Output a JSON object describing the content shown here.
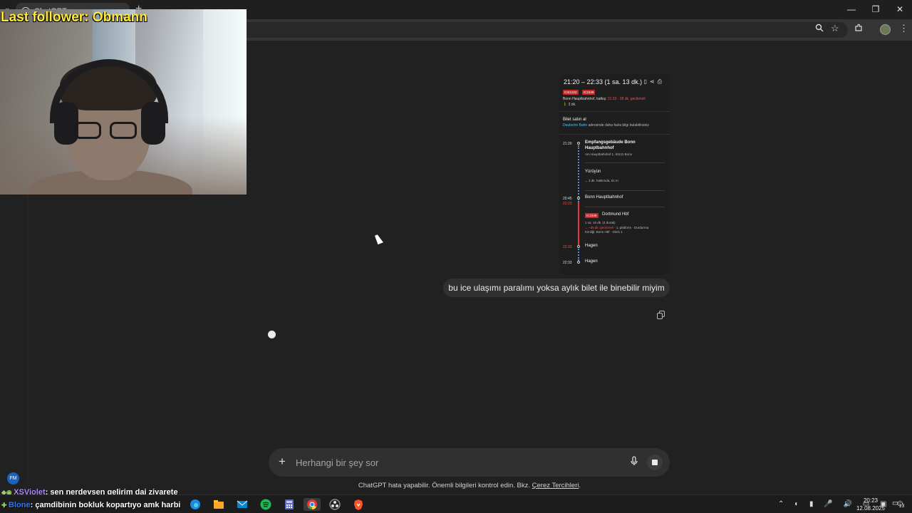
{
  "browser": {
    "tab_title": "ChatGPT",
    "tab_close": "×",
    "new_tab": "+",
    "tab_list": "⌄",
    "window_controls": [
      "—",
      "❐",
      "✕"
    ],
    "toolbar_icons": [
      "zoom-icon",
      "star-icon",
      "extensions-icon",
      "profile-avatar",
      "menu-icon"
    ]
  },
  "stream_overlay": {
    "follower_text": "Last follower: Obmann",
    "chat_badge": "FM",
    "chat_messages": [
      {
        "user": "XSViolet",
        "text": ": sen nerdeysen gelirim dai ziyarete"
      },
      {
        "user": "Blone",
        "text": ": çamdibinin bokluk kopartıyo amk harbi"
      }
    ]
  },
  "conversation": {
    "attachment": {
      "time_range": "21:20 – 22:33 (1 sa. 13 dk.)",
      "badges": [
        "ICE1222",
        "IC2349"
      ],
      "departure_text": "Bonn Hauptbahnhof, kalkış: ",
      "departure_late": "21:23 · 38 dk. gecikmeli",
      "walk": "🚶 3 dk.",
      "ticket_title": "Bilet satın al",
      "ticket_db": "Deutsche Bahn",
      "ticket_rest": " adresinde daha fazla bilgi bulabilirsiniz",
      "stops": [
        {
          "time": "21:20",
          "name": "Empfangsgebäude Bonn",
          "name2": "Hauptbahnhof",
          "sub": "Am Hauptbahnhof 1, 53111 Bonn"
        },
        {
          "time": "",
          "name": "Yürüyün",
          "sub": "⌄ 3 dk. hakkında, 61 m"
        },
        {
          "time": "20:45",
          "time_red": "21:23",
          "name": "Bonn Hauptbahnhof"
        },
        {
          "train": "IC2349",
          "name": "Dortmund Hbf",
          "sub": "1 sa. 10 dk. (4 durak)",
          "sub_red": "⌄ ~38 dk. gecikmeli",
          "sub2": " · 1. platform · Durdurma",
          "sub3": "Kimliği: Bonn Hbf · Gleis 1"
        },
        {
          "time": "22:33",
          "red": true,
          "name": "Hagen"
        },
        {
          "time": "22:33",
          "name": "Hagen"
        }
      ]
    },
    "user_message": "bu ice ulaşımı paralımı yoksa aylık bilet ile binebilir miyim"
  },
  "composer": {
    "placeholder": "Herhangi bir şey sor",
    "plus_label": "+",
    "mic_label": "🎙"
  },
  "disclaimer": {
    "text": "ChatGPT hata yapabilir. Önemli bilgileri kontrol edin. Bkz. ",
    "link": "Çerez Tercihleri",
    "end": "."
  },
  "taskbar": {
    "apps": [
      "windows-start-icon",
      "search-icon",
      "edge-icon",
      "file-explorer-icon",
      "mail-icon",
      "spotify-icon",
      "calculator-icon",
      "chrome-icon",
      "obs-icon",
      "brave-icon"
    ],
    "colors": {
      "edge": "#1e88e5",
      "files": "#f9a825",
      "mail": "#0288d1",
      "spotify": "#1db954",
      "calc": "#5c6bc0",
      "chrome": "#e53935",
      "obs": "#9e9e9e",
      "brave": "#fb542b"
    },
    "tray_icons": "⌃ ◐ ▮ 🎤 🔊 ▭ ▣ ⏻",
    "time": "20:23",
    "date": "12.08.2025",
    "notification_count": "13"
  }
}
